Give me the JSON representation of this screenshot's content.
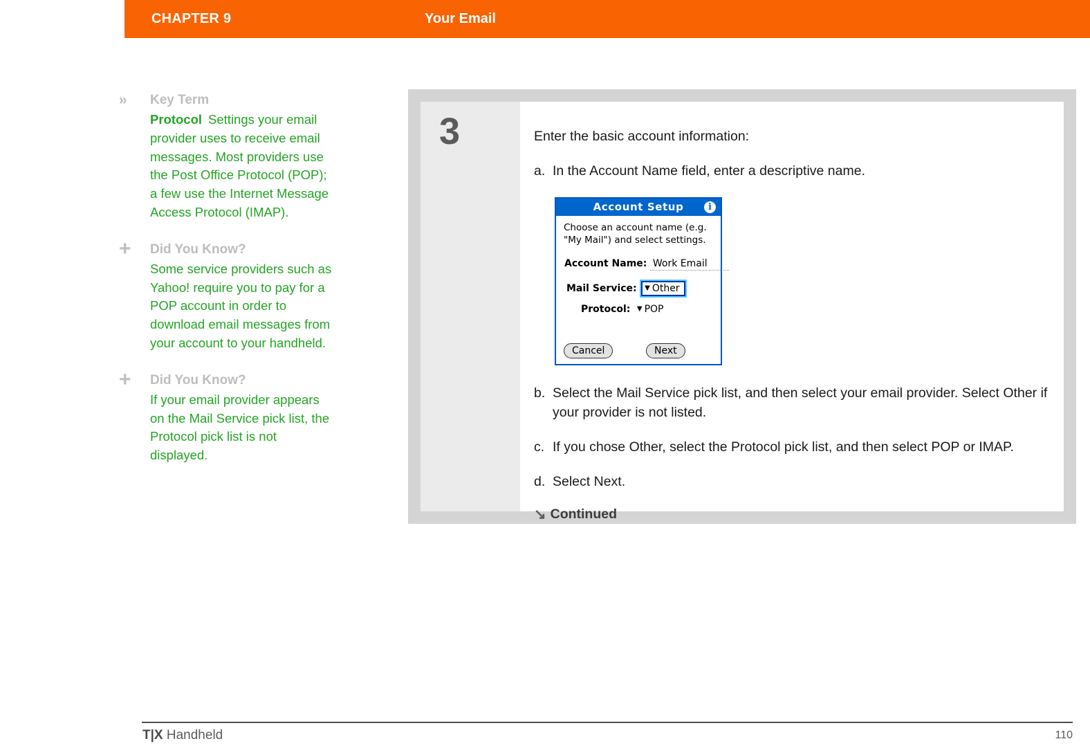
{
  "header": {
    "chapter": "CHAPTER 9",
    "title": "Your Email",
    "bar_color": "#f96302"
  },
  "sidebar": {
    "notes": [
      {
        "icon": "double-chevron-right-icon",
        "icon_glyph": "»",
        "heading": "Key Term",
        "term": "Protocol",
        "text": "Settings your email provider uses to receive email messages. Most providers use the Post Office Protocol (POP); a few use the Internet Message Access Protocol (IMAP)."
      },
      {
        "icon": "plus-icon",
        "icon_glyph": "+",
        "heading": "Did You Know?",
        "term": "",
        "text": "Some service providers such as Yahoo! require you to pay for a POP account in order to download email messages from your account to your handheld."
      },
      {
        "icon": "plus-icon",
        "icon_glyph": "+",
        "heading": "Did You Know?",
        "term": "",
        "text": "If your email provider appears on the Mail Service pick list, the Protocol pick list is not displayed."
      }
    ],
    "heading_color": "#bdbdbd",
    "text_color": "#25a425"
  },
  "step": {
    "number": "3",
    "lead": "Enter the basic account information:",
    "substeps": [
      {
        "marker": "a.",
        "text": "In the Account Name field, enter a descriptive name."
      },
      {
        "marker": "b.",
        "text": "Select the Mail Service pick list, and then select your email provider. Select Other if your provider is not listed."
      },
      {
        "marker": "c.",
        "text": "If you chose Other, select the Protocol pick list, and then select POP or IMAP."
      },
      {
        "marker": "d.",
        "text": "Select Next."
      }
    ],
    "continued_arrow": "↘",
    "continued_label": "Continued"
  },
  "pda": {
    "title": "Account Setup",
    "info_icon_glyph": "i",
    "description": "Choose an account name (e.g. \"My Mail\") and select settings.",
    "fields": [
      {
        "label": "Account Name:",
        "value": "Work Email",
        "type": "text"
      },
      {
        "label": "Mail Service:",
        "value": "Other",
        "type": "picklist",
        "selected": true
      },
      {
        "label": "Protocol:",
        "value": "POP",
        "type": "picklist",
        "selected": false
      }
    ],
    "buttons": {
      "cancel": "Cancel",
      "next": "Next"
    },
    "caret_glyph": "▼",
    "titlebar_color": "#0066cc",
    "highlight_color": "#55ccff"
  },
  "footer": {
    "product_mark": "T|X",
    "product_name": " Handheld",
    "page_number": "110"
  }
}
